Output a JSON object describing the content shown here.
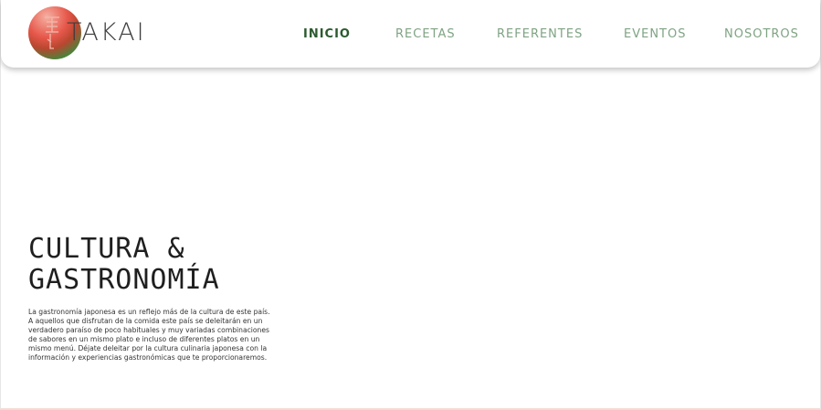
{
  "brand": {
    "name": "TAKAI",
    "logo_colors": [
      "#e6574a",
      "#2d7a30"
    ]
  },
  "nav": {
    "items": [
      {
        "label": "INICIO",
        "active": true
      },
      {
        "label": "RECETAS",
        "active": false
      },
      {
        "label": "REFERENTES",
        "active": false
      },
      {
        "label": "EVENTOS",
        "active": false
      },
      {
        "label": "NOSOTROS",
        "active": false
      }
    ],
    "active_color": "#2b5a2e",
    "inactive_color": "#7fa383"
  },
  "hero": {
    "title_line1": "CULTURA &",
    "title_line2": "GASTRONOMÍA",
    "description": "La gastronomía japonesa es un reflejo más de la cultura de este país. A aquellos que disfrutan de la comida este país se deleitarán en un verdadero paraíso de poco habituales y muy variadas combinaciones de sabores en un mismo plato e incluso de diferentes platos en un mismo menú. Déjate deleitar por la cultura culinaria japonesa con la información y experiencias gastronómicas que te proporcionaremos."
  }
}
